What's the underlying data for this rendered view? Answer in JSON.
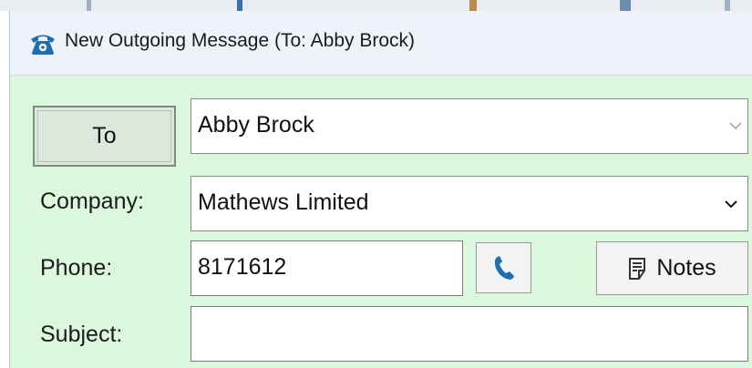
{
  "window": {
    "title": "New Outgoing Message (To: Abby Brock)",
    "icon": "telephone-icon"
  },
  "form": {
    "to_button_label": "To",
    "to_value": "Abby Brock",
    "company_label": "Company:",
    "company_value": "Mathews Limited",
    "phone_label": "Phone:",
    "phone_value": "8171612",
    "call_button_icon": "phone-handset-icon",
    "notes_button_label": "Notes",
    "notes_button_icon": "notes-icon",
    "subject_label": "Subject:",
    "subject_value": ""
  },
  "colors": {
    "form_background": "#dcf8dc",
    "titlebar_background": "#eef3fa",
    "icon_blue": "#1f6fb0"
  }
}
